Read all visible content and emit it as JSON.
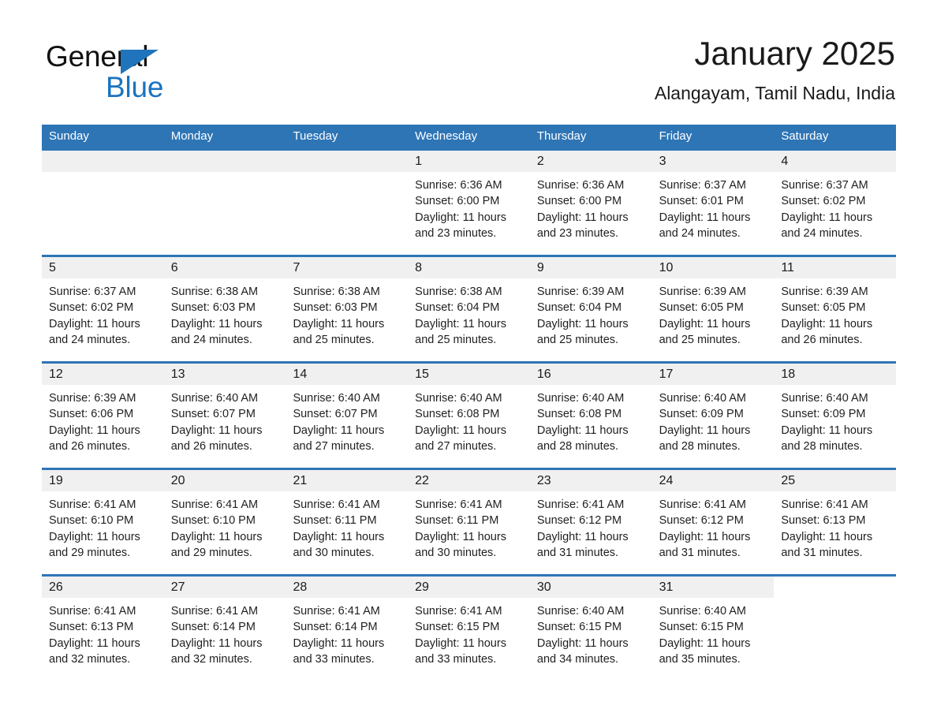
{
  "brand": {
    "name_part1": "General",
    "name_part2": "Blue",
    "triangle_icon": "triangle-icon",
    "accent_color": "#1a73c0"
  },
  "header": {
    "month_title": "January 2025",
    "location": "Alangayam, Tamil Nadu, India"
  },
  "calendar": {
    "header_color": "#2e75b6",
    "weekdays": [
      "Sunday",
      "Monday",
      "Tuesday",
      "Wednesday",
      "Thursday",
      "Friday",
      "Saturday"
    ],
    "weeks": [
      [
        {
          "day": "",
          "sunrise": "",
          "sunset": "",
          "daylight_1": "",
          "daylight_2": ""
        },
        {
          "day": "",
          "sunrise": "",
          "sunset": "",
          "daylight_1": "",
          "daylight_2": ""
        },
        {
          "day": "",
          "sunrise": "",
          "sunset": "",
          "daylight_1": "",
          "daylight_2": ""
        },
        {
          "day": "1",
          "sunrise": "Sunrise: 6:36 AM",
          "sunset": "Sunset: 6:00 PM",
          "daylight_1": "Daylight: 11 hours",
          "daylight_2": "and 23 minutes."
        },
        {
          "day": "2",
          "sunrise": "Sunrise: 6:36 AM",
          "sunset": "Sunset: 6:00 PM",
          "daylight_1": "Daylight: 11 hours",
          "daylight_2": "and 23 minutes."
        },
        {
          "day": "3",
          "sunrise": "Sunrise: 6:37 AM",
          "sunset": "Sunset: 6:01 PM",
          "daylight_1": "Daylight: 11 hours",
          "daylight_2": "and 24 minutes."
        },
        {
          "day": "4",
          "sunrise": "Sunrise: 6:37 AM",
          "sunset": "Sunset: 6:02 PM",
          "daylight_1": "Daylight: 11 hours",
          "daylight_2": "and 24 minutes."
        }
      ],
      [
        {
          "day": "5",
          "sunrise": "Sunrise: 6:37 AM",
          "sunset": "Sunset: 6:02 PM",
          "daylight_1": "Daylight: 11 hours",
          "daylight_2": "and 24 minutes."
        },
        {
          "day": "6",
          "sunrise": "Sunrise: 6:38 AM",
          "sunset": "Sunset: 6:03 PM",
          "daylight_1": "Daylight: 11 hours",
          "daylight_2": "and 24 minutes."
        },
        {
          "day": "7",
          "sunrise": "Sunrise: 6:38 AM",
          "sunset": "Sunset: 6:03 PM",
          "daylight_1": "Daylight: 11 hours",
          "daylight_2": "and 25 minutes."
        },
        {
          "day": "8",
          "sunrise": "Sunrise: 6:38 AM",
          "sunset": "Sunset: 6:04 PM",
          "daylight_1": "Daylight: 11 hours",
          "daylight_2": "and 25 minutes."
        },
        {
          "day": "9",
          "sunrise": "Sunrise: 6:39 AM",
          "sunset": "Sunset: 6:04 PM",
          "daylight_1": "Daylight: 11 hours",
          "daylight_2": "and 25 minutes."
        },
        {
          "day": "10",
          "sunrise": "Sunrise: 6:39 AM",
          "sunset": "Sunset: 6:05 PM",
          "daylight_1": "Daylight: 11 hours",
          "daylight_2": "and 25 minutes."
        },
        {
          "day": "11",
          "sunrise": "Sunrise: 6:39 AM",
          "sunset": "Sunset: 6:05 PM",
          "daylight_1": "Daylight: 11 hours",
          "daylight_2": "and 26 minutes."
        }
      ],
      [
        {
          "day": "12",
          "sunrise": "Sunrise: 6:39 AM",
          "sunset": "Sunset: 6:06 PM",
          "daylight_1": "Daylight: 11 hours",
          "daylight_2": "and 26 minutes."
        },
        {
          "day": "13",
          "sunrise": "Sunrise: 6:40 AM",
          "sunset": "Sunset: 6:07 PM",
          "daylight_1": "Daylight: 11 hours",
          "daylight_2": "and 26 minutes."
        },
        {
          "day": "14",
          "sunrise": "Sunrise: 6:40 AM",
          "sunset": "Sunset: 6:07 PM",
          "daylight_1": "Daylight: 11 hours",
          "daylight_2": "and 27 minutes."
        },
        {
          "day": "15",
          "sunrise": "Sunrise: 6:40 AM",
          "sunset": "Sunset: 6:08 PM",
          "daylight_1": "Daylight: 11 hours",
          "daylight_2": "and 27 minutes."
        },
        {
          "day": "16",
          "sunrise": "Sunrise: 6:40 AM",
          "sunset": "Sunset: 6:08 PM",
          "daylight_1": "Daylight: 11 hours",
          "daylight_2": "and 28 minutes."
        },
        {
          "day": "17",
          "sunrise": "Sunrise: 6:40 AM",
          "sunset": "Sunset: 6:09 PM",
          "daylight_1": "Daylight: 11 hours",
          "daylight_2": "and 28 minutes."
        },
        {
          "day": "18",
          "sunrise": "Sunrise: 6:40 AM",
          "sunset": "Sunset: 6:09 PM",
          "daylight_1": "Daylight: 11 hours",
          "daylight_2": "and 28 minutes."
        }
      ],
      [
        {
          "day": "19",
          "sunrise": "Sunrise: 6:41 AM",
          "sunset": "Sunset: 6:10 PM",
          "daylight_1": "Daylight: 11 hours",
          "daylight_2": "and 29 minutes."
        },
        {
          "day": "20",
          "sunrise": "Sunrise: 6:41 AM",
          "sunset": "Sunset: 6:10 PM",
          "daylight_1": "Daylight: 11 hours",
          "daylight_2": "and 29 minutes."
        },
        {
          "day": "21",
          "sunrise": "Sunrise: 6:41 AM",
          "sunset": "Sunset: 6:11 PM",
          "daylight_1": "Daylight: 11 hours",
          "daylight_2": "and 30 minutes."
        },
        {
          "day": "22",
          "sunrise": "Sunrise: 6:41 AM",
          "sunset": "Sunset: 6:11 PM",
          "daylight_1": "Daylight: 11 hours",
          "daylight_2": "and 30 minutes."
        },
        {
          "day": "23",
          "sunrise": "Sunrise: 6:41 AM",
          "sunset": "Sunset: 6:12 PM",
          "daylight_1": "Daylight: 11 hours",
          "daylight_2": "and 31 minutes."
        },
        {
          "day": "24",
          "sunrise": "Sunrise: 6:41 AM",
          "sunset": "Sunset: 6:12 PM",
          "daylight_1": "Daylight: 11 hours",
          "daylight_2": "and 31 minutes."
        },
        {
          "day": "25",
          "sunrise": "Sunrise: 6:41 AM",
          "sunset": "Sunset: 6:13 PM",
          "daylight_1": "Daylight: 11 hours",
          "daylight_2": "and 31 minutes."
        }
      ],
      [
        {
          "day": "26",
          "sunrise": "Sunrise: 6:41 AM",
          "sunset": "Sunset: 6:13 PM",
          "daylight_1": "Daylight: 11 hours",
          "daylight_2": "and 32 minutes."
        },
        {
          "day": "27",
          "sunrise": "Sunrise: 6:41 AM",
          "sunset": "Sunset: 6:14 PM",
          "daylight_1": "Daylight: 11 hours",
          "daylight_2": "and 32 minutes."
        },
        {
          "day": "28",
          "sunrise": "Sunrise: 6:41 AM",
          "sunset": "Sunset: 6:14 PM",
          "daylight_1": "Daylight: 11 hours",
          "daylight_2": "and 33 minutes."
        },
        {
          "day": "29",
          "sunrise": "Sunrise: 6:41 AM",
          "sunset": "Sunset: 6:15 PM",
          "daylight_1": "Daylight: 11 hours",
          "daylight_2": "and 33 minutes."
        },
        {
          "day": "30",
          "sunrise": "Sunrise: 6:40 AM",
          "sunset": "Sunset: 6:15 PM",
          "daylight_1": "Daylight: 11 hours",
          "daylight_2": "and 34 minutes."
        },
        {
          "day": "31",
          "sunrise": "Sunrise: 6:40 AM",
          "sunset": "Sunset: 6:15 PM",
          "daylight_1": "Daylight: 11 hours",
          "daylight_2": "and 35 minutes."
        },
        {
          "day": "",
          "sunrise": "",
          "sunset": "",
          "daylight_1": "",
          "daylight_2": ""
        }
      ]
    ]
  }
}
